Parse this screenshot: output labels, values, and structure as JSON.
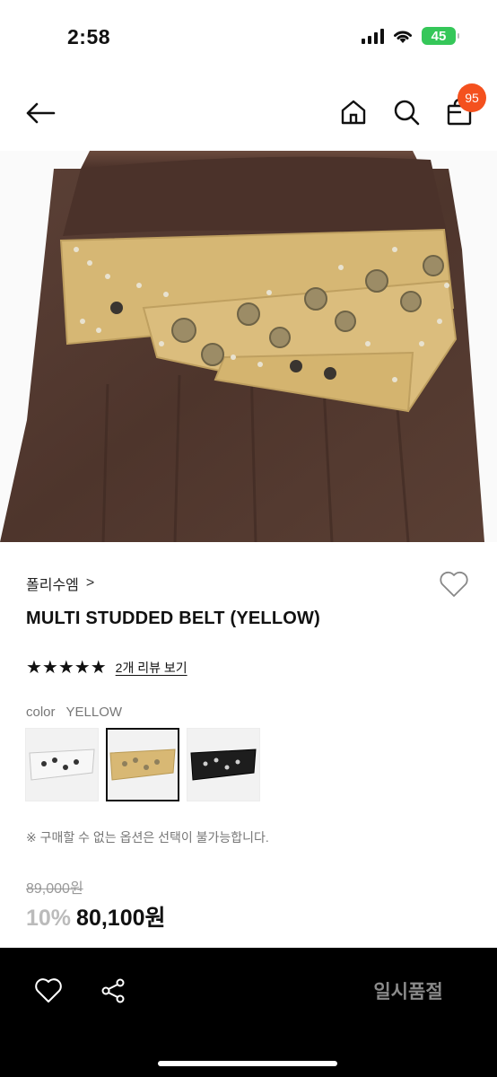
{
  "status_bar": {
    "time": "2:58",
    "battery": "45"
  },
  "header": {
    "icons": [
      "back-arrow-icon",
      "home-icon",
      "search-icon",
      "shopping-bag-icon"
    ],
    "cart_count": "95"
  },
  "product": {
    "brand": "폴리수엠",
    "brand_chevron": ">",
    "title": "MULTI STUDDED BELT (YELLOW)",
    "rating_stars": "★★★★★",
    "review_link": "2개 리뷰 보기",
    "color_label": "color",
    "color_value": "YELLOW",
    "swatches": [
      {
        "name": "white",
        "color": "#f4f4f4"
      },
      {
        "name": "yellow",
        "color": "#d8b874",
        "selected": true
      },
      {
        "name": "black",
        "color": "#1d1d1d"
      }
    ],
    "notice": "※ 구매할 수 없는 옵션은 선택이 불가능합니다.",
    "original_price": "89,000원",
    "discount": "10%",
    "sale_price": "80,100원"
  },
  "bottom_bar": {
    "soldout_label": "일시품절",
    "icons": [
      "heart-icon",
      "share-icon"
    ]
  },
  "colors": {
    "accent_badge": "#f4511e",
    "bar_bg": "#000000"
  }
}
